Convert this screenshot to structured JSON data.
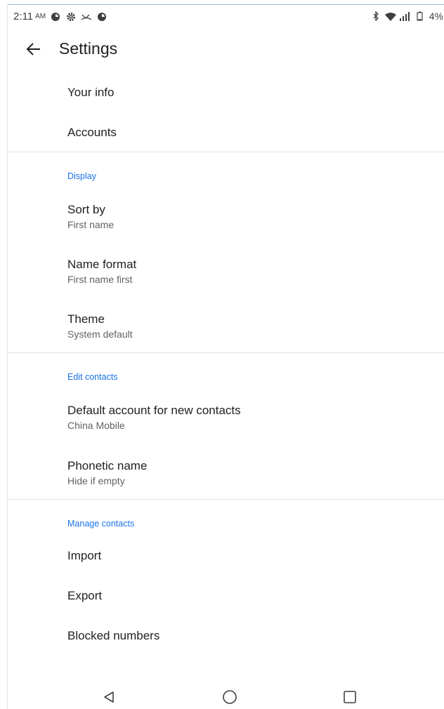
{
  "status_bar": {
    "time": "2:11",
    "ampm": "AM",
    "battery": "4%",
    "left_icons": [
      "app-circle-icon",
      "gear-icon",
      "missed-call-icon",
      "app-circle-icon"
    ],
    "right_icons": [
      "bluetooth-icon",
      "wifi-icon",
      "signal-icon",
      "battery-icon"
    ]
  },
  "app_bar": {
    "title": "Settings",
    "back_icon": "arrow-left-icon"
  },
  "items_top": [
    {
      "title": "Your info"
    },
    {
      "title": "Accounts"
    }
  ],
  "display": {
    "header": "Display",
    "items": [
      {
        "title": "Sort by",
        "subtitle": "First name"
      },
      {
        "title": "Name format",
        "subtitle": "First name first"
      },
      {
        "title": "Theme",
        "subtitle": "System default"
      }
    ]
  },
  "edit_contacts": {
    "header": "Edit contacts",
    "items": [
      {
        "title": "Default account for new contacts",
        "subtitle": "China Mobile"
      },
      {
        "title": "Phonetic name",
        "subtitle": "Hide if empty"
      }
    ]
  },
  "manage_contacts": {
    "header": "Manage contacts",
    "items": [
      {
        "title": "Import"
      },
      {
        "title": "Export"
      },
      {
        "title": "Blocked numbers"
      }
    ]
  },
  "nav_bar": {
    "icons": [
      "back-triangle-icon",
      "home-circle-icon",
      "recents-square-icon"
    ]
  },
  "colors": {
    "accent": "#1a73e8",
    "text_primary": "#202124",
    "text_secondary": "#5f6368",
    "divider": "#e3e3e3"
  }
}
